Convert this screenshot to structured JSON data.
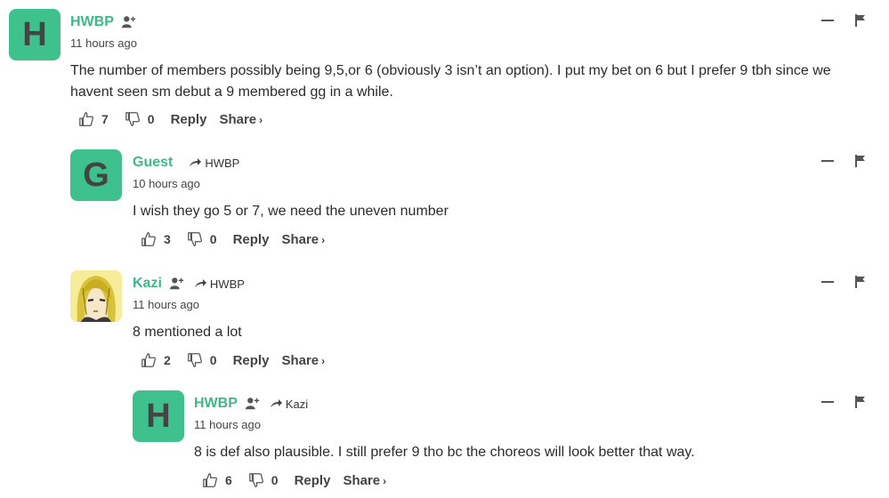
{
  "comments": [
    {
      "author": "HWBP",
      "avatar_letter": "H",
      "avatar_type": "letter",
      "show_follow": true,
      "reply_to": "",
      "time": "11 hours ago",
      "text": "The number of members possibly being 9,5,or 6 (obviously 3 isn’t an option). I put my bet on 6 but I prefer 9 tbh since we havent seen sm debut a 9 membered gg in a while.",
      "upvotes": "7",
      "downvotes": "0"
    },
    {
      "author": "Guest",
      "avatar_letter": "G",
      "avatar_type": "letter",
      "show_follow": false,
      "reply_to": "HWBP",
      "time": "10 hours ago",
      "text": "I wish they go 5 or 7, we need the uneven number",
      "upvotes": "3",
      "downvotes": "0"
    },
    {
      "author": "Kazi",
      "avatar_letter": "",
      "avatar_type": "image",
      "show_follow": true,
      "reply_to": "HWBP",
      "time": "11 hours ago",
      "text": "8 mentioned a lot",
      "upvotes": "2",
      "downvotes": "0"
    },
    {
      "author": "HWBP",
      "avatar_letter": "H",
      "avatar_type": "letter",
      "show_follow": true,
      "reply_to": "Kazi",
      "time": "11 hours ago",
      "text": "8 is def also plausible. I still prefer 9 tho bc the choreos will look better that way.",
      "upvotes": "6",
      "downvotes": "0"
    }
  ],
  "labels": {
    "reply": "Reply",
    "share": "Share",
    "share_chevron": "›"
  },
  "colors": {
    "accent": "#3fb886",
    "avatar_bg": "#3fc18e"
  },
  "icons": [
    "follow-user-icon",
    "reply-arrow-icon",
    "thumbs-up-icon",
    "thumbs-down-icon",
    "collapse-icon",
    "flag-icon"
  ]
}
